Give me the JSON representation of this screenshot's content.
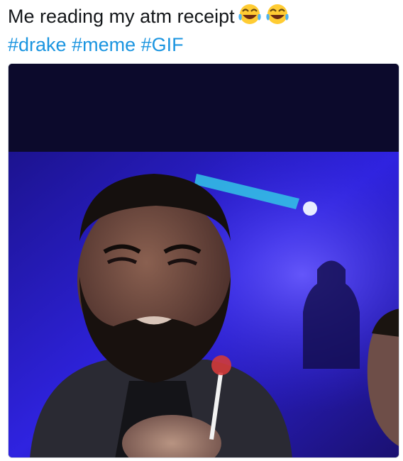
{
  "tweet": {
    "text": "Me reading my atm receipt",
    "emoji": [
      "face-with-tears-of-joy-icon",
      "face-with-tears-of-joy-icon"
    ],
    "hashtags": [
      "#drake",
      "#meme",
      "#GIF"
    ]
  },
  "media": {
    "type": "gif",
    "colors": {
      "letterbox": "#0c0a2c",
      "background": "#2a1fd6",
      "accent_light": "#33c6e6",
      "skin": "#6a4a3c"
    }
  }
}
